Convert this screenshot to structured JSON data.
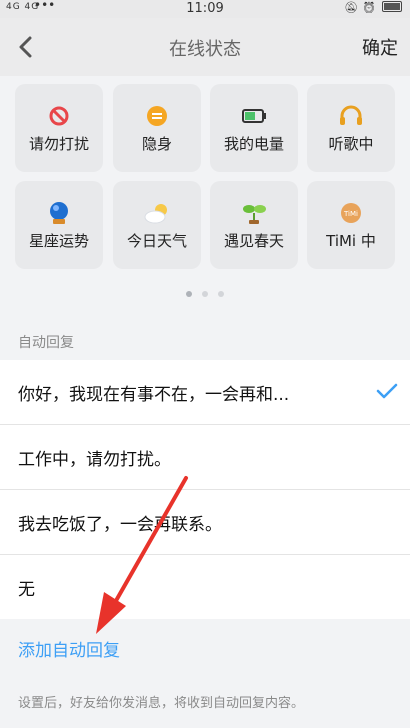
{
  "status_bar": {
    "network": "4G 4G",
    "dots": "•••",
    "time": "11:09",
    "icons": [
      "mute-icon",
      "alarm-icon",
      "battery-icon"
    ]
  },
  "nav": {
    "back_icon": "chevron-left-icon",
    "title": "在线状态",
    "confirm_label": "确定"
  },
  "status_options": [
    {
      "label": "请勿打扰",
      "icon": "no-disturb-icon"
    },
    {
      "label": "隐身",
      "icon": "invisible-icon"
    },
    {
      "label": "我的电量",
      "icon": "battery-icon"
    },
    {
      "label": "听歌中",
      "icon": "headphones-icon"
    },
    {
      "label": "星座运势",
      "icon": "crystal-ball-icon"
    },
    {
      "label": "今日天气",
      "icon": "weather-icon"
    },
    {
      "label": "遇见春天",
      "icon": "sprout-icon"
    },
    {
      "label": "TiMi 中",
      "icon": "timi-icon"
    }
  ],
  "pager": {
    "pages": 3,
    "active": 1
  },
  "auto_reply": {
    "section_label": "自动回复",
    "items": [
      {
        "text": "你好，我现在有事不在，一会再和...",
        "selected": true
      },
      {
        "text": "工作中，请勿打扰。",
        "selected": false
      },
      {
        "text": "我去吃饭了，一会再联系。",
        "selected": false
      },
      {
        "text": "无",
        "selected": false
      }
    ],
    "add_label": "添加自动回复",
    "hint": "设置后，好友给你发消息，将收到自动回复内容。"
  },
  "colors": {
    "accent": "#3d9ff5",
    "arrow": "#e8332b"
  }
}
